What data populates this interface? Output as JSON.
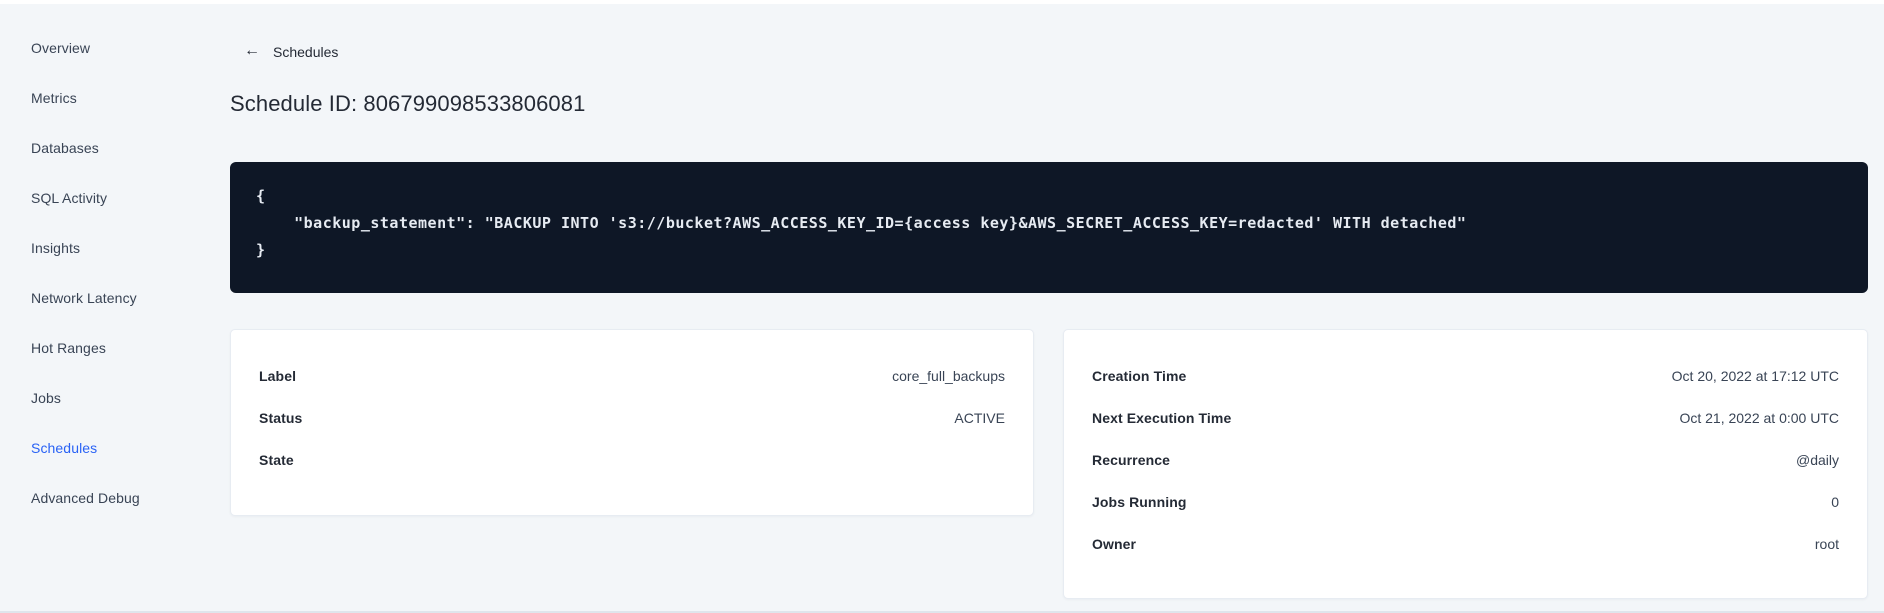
{
  "colors": {
    "accent_blue": "#2962f5",
    "code_block_bg": "#0e1726",
    "page_bg": "#f3f6f9"
  },
  "icons": {
    "back_arrow": "←"
  },
  "sidebar": {
    "items": [
      {
        "label": "Overview",
        "active": false
      },
      {
        "label": "Metrics",
        "active": false
      },
      {
        "label": "Databases",
        "active": false
      },
      {
        "label": "SQL Activity",
        "active": false
      },
      {
        "label": "Insights",
        "active": false
      },
      {
        "label": "Network Latency",
        "active": false
      },
      {
        "label": "Hot Ranges",
        "active": false
      },
      {
        "label": "Jobs",
        "active": false
      },
      {
        "label": "Schedules",
        "active": true
      },
      {
        "label": "Advanced Debug",
        "active": false
      }
    ]
  },
  "header": {
    "back_label": "Schedules",
    "title": "Schedule ID: 806799098533806081"
  },
  "code_block": {
    "text": "{\n    \"backup_statement\": \"BACKUP INTO 's3://bucket?AWS_ACCESS_KEY_ID={access key}&AWS_SECRET_ACCESS_KEY=redacted' WITH detached\"\n}"
  },
  "details_card": {
    "rows": [
      {
        "label": "Label",
        "value": "core_full_backups"
      },
      {
        "label": "Status",
        "value": "ACTIVE"
      },
      {
        "label": "State",
        "value": ""
      }
    ]
  },
  "schedule_card": {
    "rows": [
      {
        "label": "Creation Time",
        "value": "Oct 20, 2022 at 17:12 UTC"
      },
      {
        "label": "Next Execution Time",
        "value": "Oct 21, 2022 at 0:00 UTC"
      },
      {
        "label": "Recurrence",
        "value": "@daily"
      },
      {
        "label": "Jobs Running",
        "value": "0"
      },
      {
        "label": "Owner",
        "value": "root"
      }
    ]
  }
}
